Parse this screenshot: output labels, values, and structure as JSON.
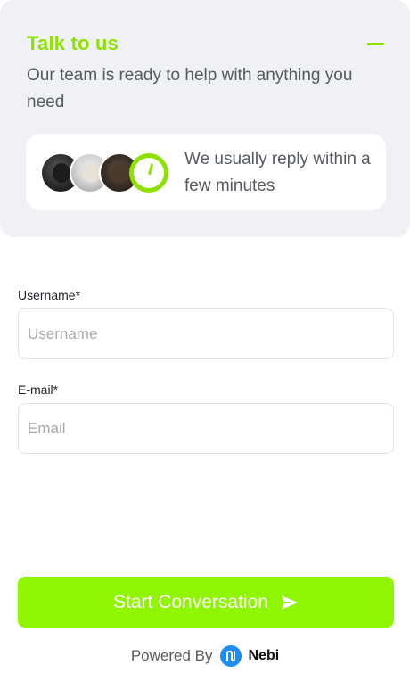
{
  "header": {
    "title": "Talk to us",
    "subtitle": "Our team is ready to help with anything you need",
    "collapse_icon": "minus-icon",
    "accent_color": "#8ee000",
    "reply_card": {
      "text": "We usually reply within a few minutes",
      "avatars": [
        "avatar-1",
        "avatar-2",
        "avatar-3"
      ],
      "status_icon": "clock-icon"
    }
  },
  "form": {
    "username": {
      "label": "Username*",
      "placeholder": "Username",
      "value": ""
    },
    "email": {
      "label": "E-mail*",
      "placeholder": "Email",
      "value": ""
    }
  },
  "actions": {
    "start_label": "Start Conversation",
    "start_icon": "send-icon",
    "button_color": "#8ff500"
  },
  "footer": {
    "powered_text": "Powered By",
    "brand_name": "Nebi",
    "brand_icon": "nebi-logo-icon",
    "brand_color": "#1f8cf0"
  }
}
